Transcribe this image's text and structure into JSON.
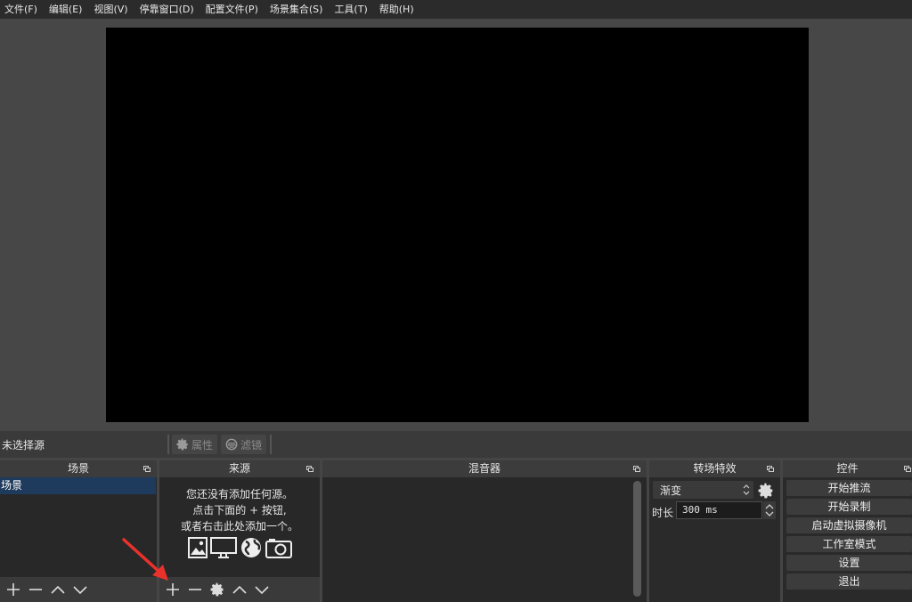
{
  "menu": [
    "文件(F)",
    "编辑(E)",
    "视图(V)",
    "停靠窗口(D)",
    "配置文件(P)",
    "场景集合(S)",
    "工具(T)",
    "帮助(H)"
  ],
  "context_bar": {
    "no_source": "未选择源",
    "properties": "属性",
    "filters": "滤镜"
  },
  "scenes": {
    "title": "场景",
    "items": [
      "场景"
    ]
  },
  "sources": {
    "title": "来源",
    "hint_line1": "您还没有添加任何源。",
    "hint_line2": "点击下面的 + 按钮,",
    "hint_line3": "或者右击此处添加一个。"
  },
  "mixer": {
    "title": "混音器"
  },
  "transitions": {
    "title": "转场特效",
    "selected": "渐变",
    "duration_label": "时长",
    "duration_value": "300 ms"
  },
  "controls": {
    "title": "控件",
    "start_streaming": "开始推流",
    "start_recording": "开始录制",
    "start_virtual_camera": "启动虚拟摄像机",
    "studio_mode": "工作室模式",
    "settings": "设置",
    "exit": "退出"
  },
  "colors": {
    "menubar": "#2b2b2b",
    "background": "#454545",
    "selected_scene": "#1e3a5c",
    "annotation_arrow": "#e8322b"
  }
}
